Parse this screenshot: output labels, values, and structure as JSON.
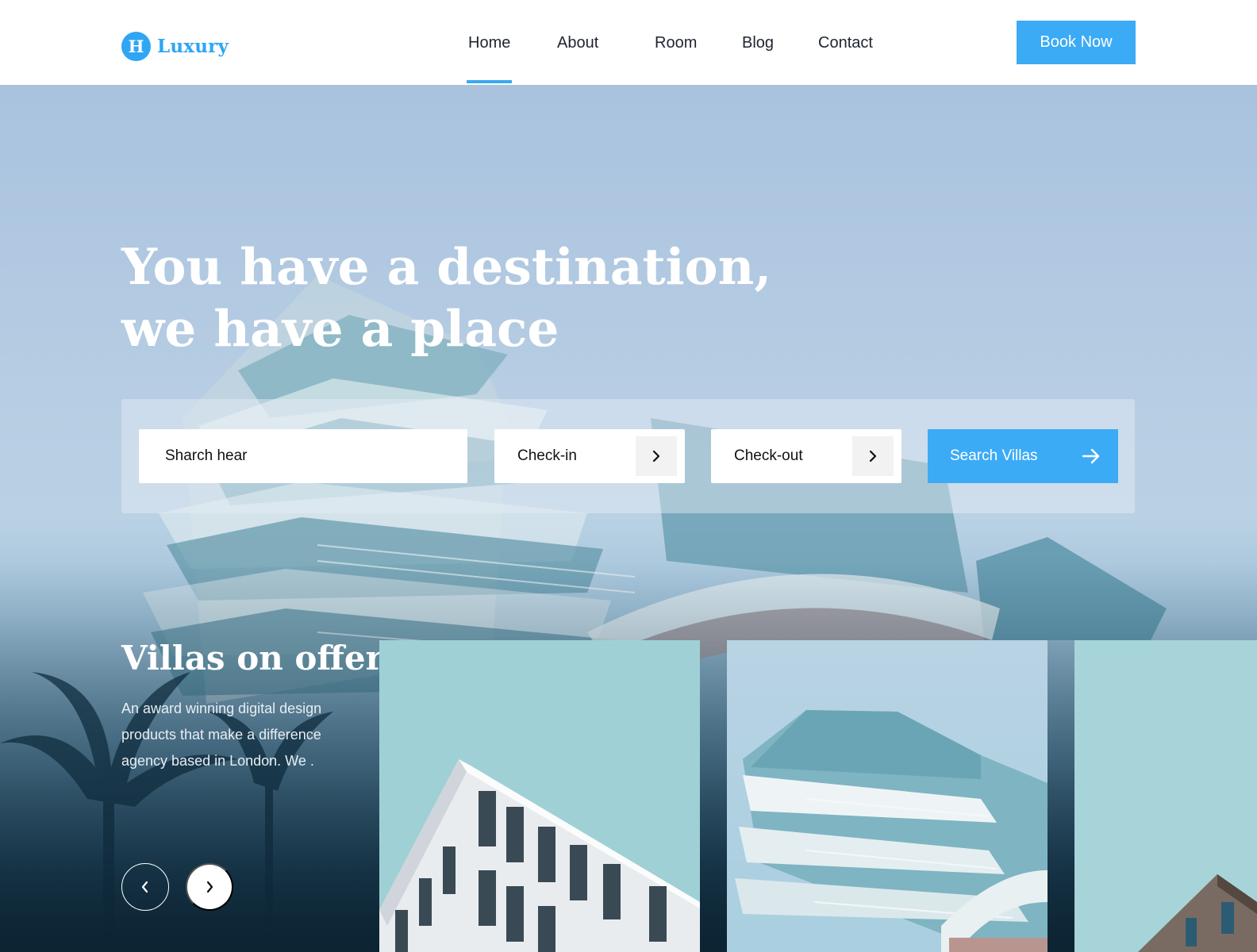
{
  "brand": {
    "logo_letter": "H",
    "name": "Luxury",
    "accent": "#3cabf5"
  },
  "nav": {
    "items": [
      {
        "label": "Home",
        "active": true
      },
      {
        "label": "About"
      },
      {
        "label": "Room"
      },
      {
        "label": "Blog"
      },
      {
        "label": "Contact"
      }
    ],
    "cta": "Book Now"
  },
  "hero": {
    "title_line1": "You have a destination,",
    "title_line2": "we have a place"
  },
  "search": {
    "query_value": "Sharch hear",
    "checkin_label": "Check-in",
    "checkout_label": "Check-out",
    "button_label": "Search Villas",
    "icons": {
      "date": "chevron-right-icon",
      "submit": "arrow-right-icon"
    }
  },
  "villas": {
    "title": "Villas on offer",
    "description": "An award winning digital design products that  make a difference agency based in London. We .",
    "icons": {
      "prev": "chevron-left-icon",
      "next": "chevron-right-icon"
    }
  }
}
